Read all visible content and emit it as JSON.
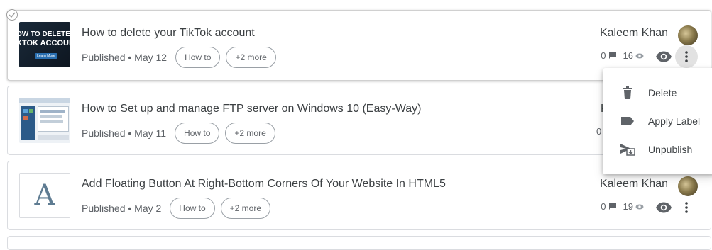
{
  "posts": [
    {
      "title": "How to delete your TikTok account",
      "status": "Published • May 12",
      "label_chip": "How to",
      "more_chip": "+2 more",
      "author": "Kaleem Khan",
      "comments": "0",
      "views": "16",
      "thumb_text_1": "OW TO DELETE YO",
      "thumb_text_2": "KTOK ACCOUN",
      "thumb_button": "Learn More"
    },
    {
      "title": "How to Set up and manage FTP server on Windows 10 (Easy-Way)",
      "status": "Published • May 11",
      "label_chip": "How to",
      "more_chip": "+2 more",
      "author_partial": "K",
      "comments_partial": "0"
    },
    {
      "title": "Add Floating Button At Right-Bottom Corners Of Your Website In HTML5",
      "status": "Published • May 2",
      "thumb_letter": "A",
      "label_chip": "How to",
      "more_chip": "+2 more",
      "author": "Kaleem Khan",
      "comments": "0",
      "views": "19"
    }
  ],
  "context_menu": {
    "items": [
      {
        "label": "Delete",
        "icon": "trash-icon"
      },
      {
        "label": "Apply Label",
        "icon": "label-icon"
      },
      {
        "label": "Unpublish",
        "icon": "unpublish-icon"
      }
    ]
  },
  "colors": {
    "icon_gray": "#5f6368",
    "border": "#dadce0",
    "text": "#3c4043"
  }
}
